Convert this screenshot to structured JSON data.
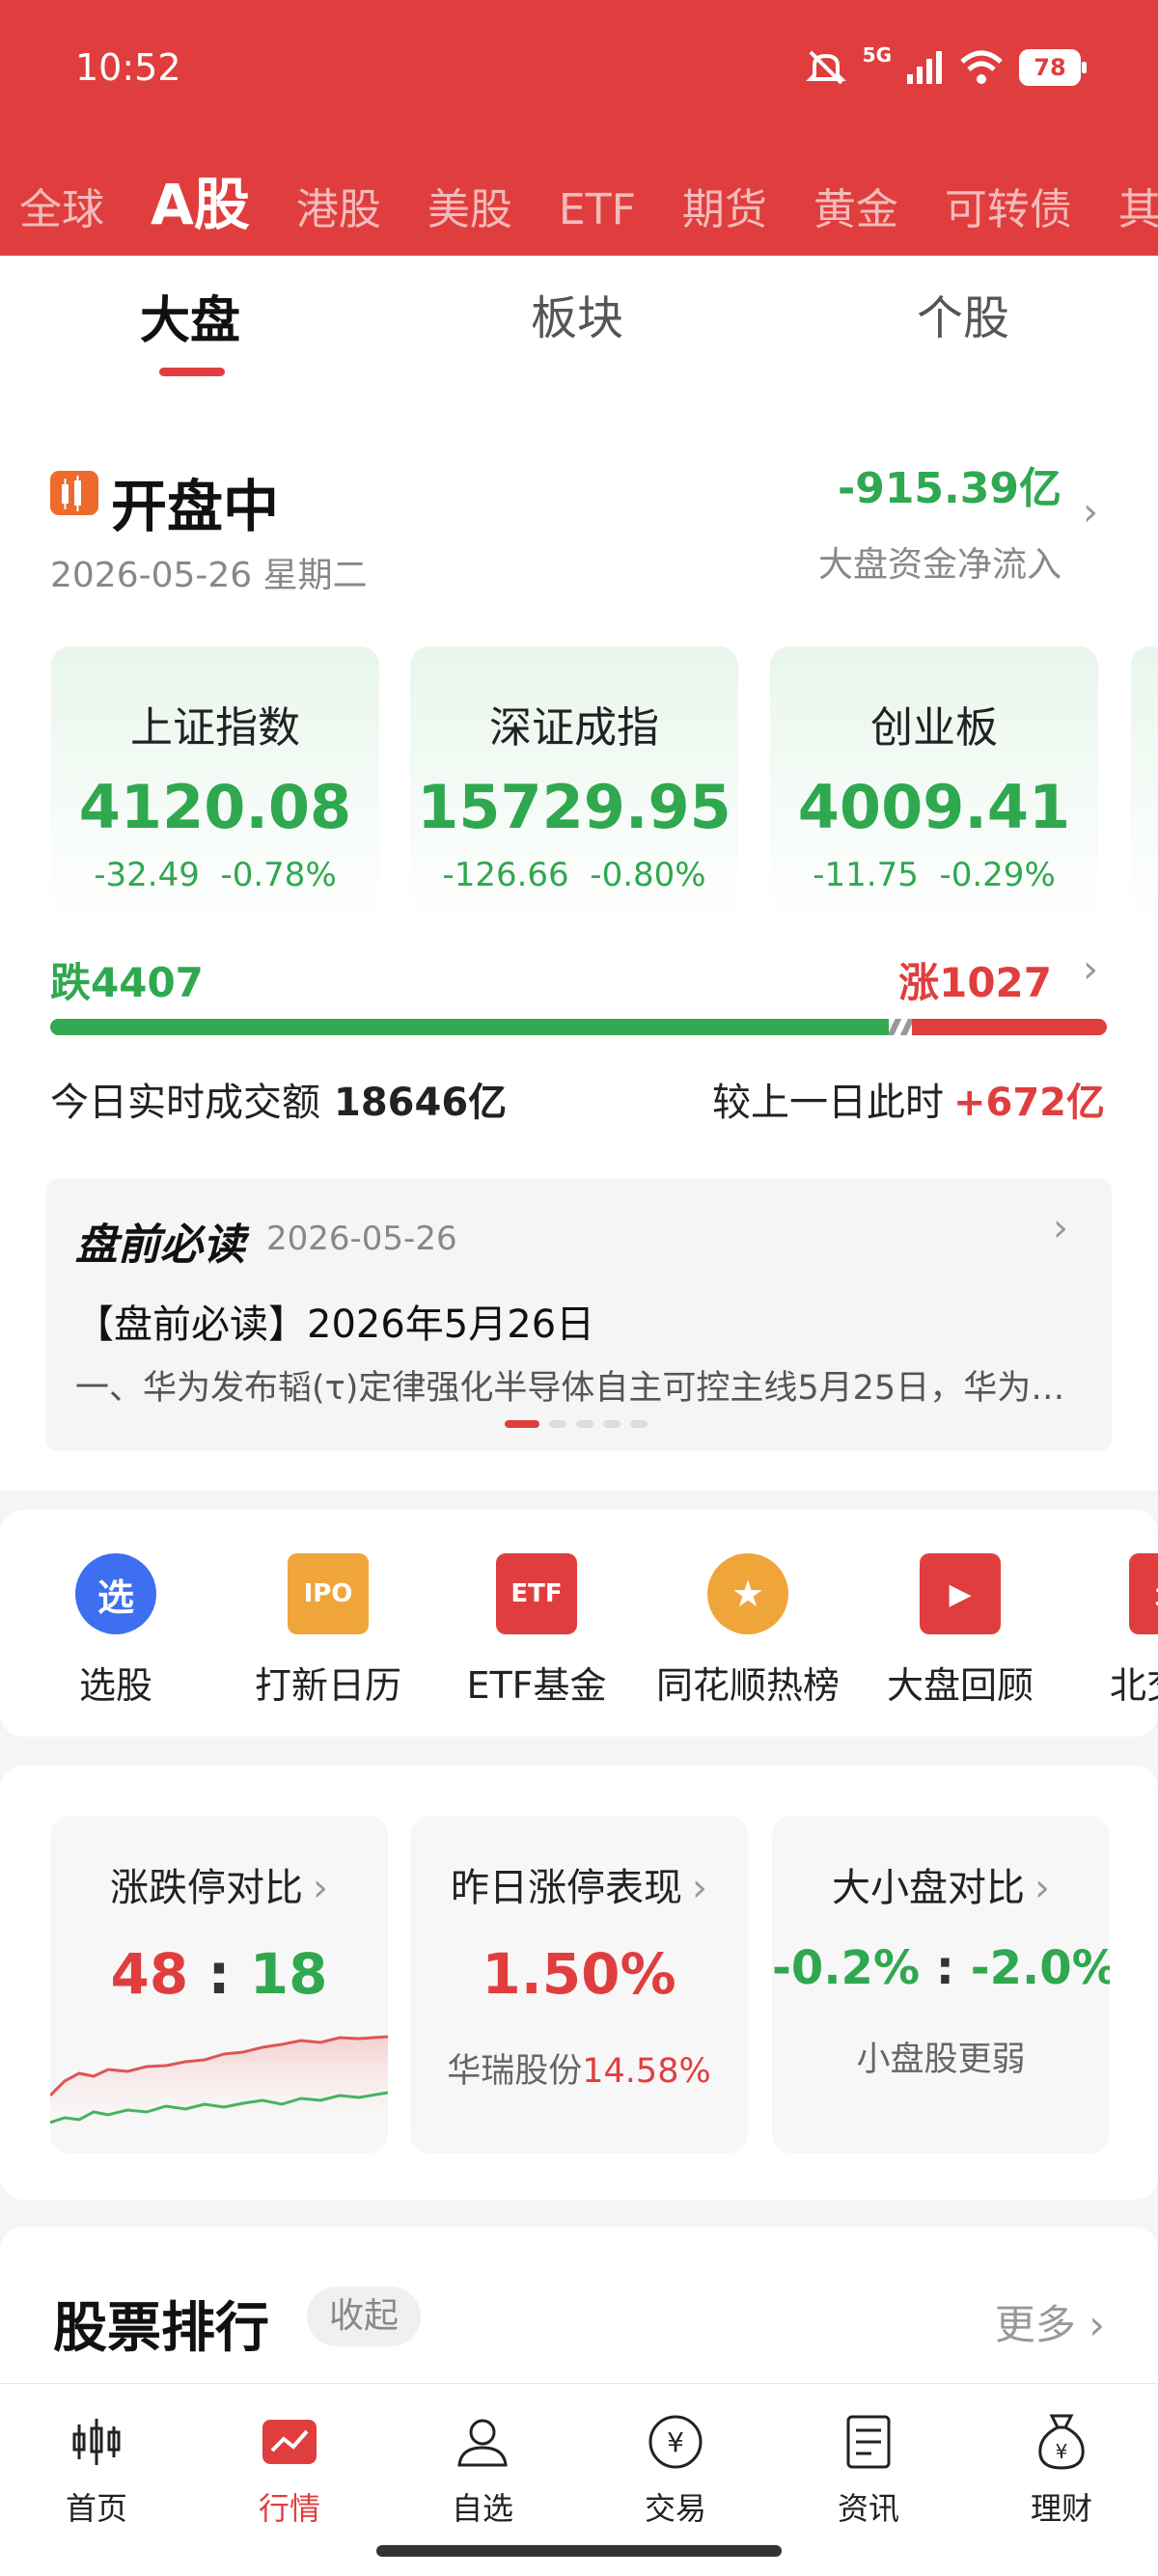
{
  "status_bar": {
    "time": "10:52",
    "network": "5G",
    "battery": "78"
  },
  "market_tabs": [
    "全球",
    "A股",
    "港股",
    "美股",
    "ETF",
    "期货",
    "黄金",
    "可转债",
    "其他"
  ],
  "sub_tabs": [
    "大盘",
    "板块",
    "个股"
  ],
  "market_status": {
    "title": "开盘中",
    "date": "2026-05-26 星期二",
    "net_flow_value": "-915.39亿",
    "net_flow_label": "大盘资金净流入"
  },
  "indices": [
    {
      "name": "上证指数",
      "value": "4120.08",
      "change": "-32.49",
      "pct": "-0.78%"
    },
    {
      "name": "深证成指",
      "value": "15729.95",
      "change": "-126.66",
      "pct": "-0.80%"
    },
    {
      "name": "创业板",
      "value": "4009.41",
      "change": "-11.75",
      "pct": "-0.29%"
    }
  ],
  "breadth": {
    "fall_label": "跌4407",
    "rise_label": "涨1027",
    "fall_count": 4407,
    "rise_count": 1027
  },
  "volume": {
    "label": "今日实时成交额",
    "value": "18646亿",
    "compare_label": "较上一日此时",
    "compare_value": "+672亿"
  },
  "news": {
    "brand": "盘前必读",
    "date": "2026-05-26",
    "title": "【盘前必读】2026年5月26日",
    "body": "一、华为发布韬(τ)定律强化半导体自主可控主线5月25日，华为…"
  },
  "tools": [
    {
      "label": "选股",
      "icon": "选"
    },
    {
      "label": "打新日历",
      "icon": "IPO"
    },
    {
      "label": "ETF基金",
      "icon": "ETF"
    },
    {
      "label": "同花顺热榜",
      "icon": "★"
    },
    {
      "label": "大盘回顾",
      "icon": "▶"
    },
    {
      "label": "北交所",
      "icon": "北"
    }
  ],
  "stat_cards": [
    {
      "title": "涨跌停对比",
      "left": "48",
      "sep": ":",
      "right": "18"
    },
    {
      "title": "昨日涨停表现",
      "value": "1.50%",
      "sub_name": "华瑞股份",
      "sub_value": "14.58%"
    },
    {
      "title": "大小盘对比",
      "left": "-0.2%",
      "sep": ":",
      "right": "-2.0%",
      "sub": "小盘股更弱"
    }
  ],
  "ranking": {
    "title": "股票排行",
    "collapse": "收起",
    "more": "更多"
  },
  "bottom_nav": [
    "首页",
    "行情",
    "自选",
    "交易",
    "资讯",
    "理财"
  ],
  "colors": {
    "brand_red": "#e03e3e",
    "down_green": "#2fa84f",
    "up_red": "#e03e3e"
  }
}
